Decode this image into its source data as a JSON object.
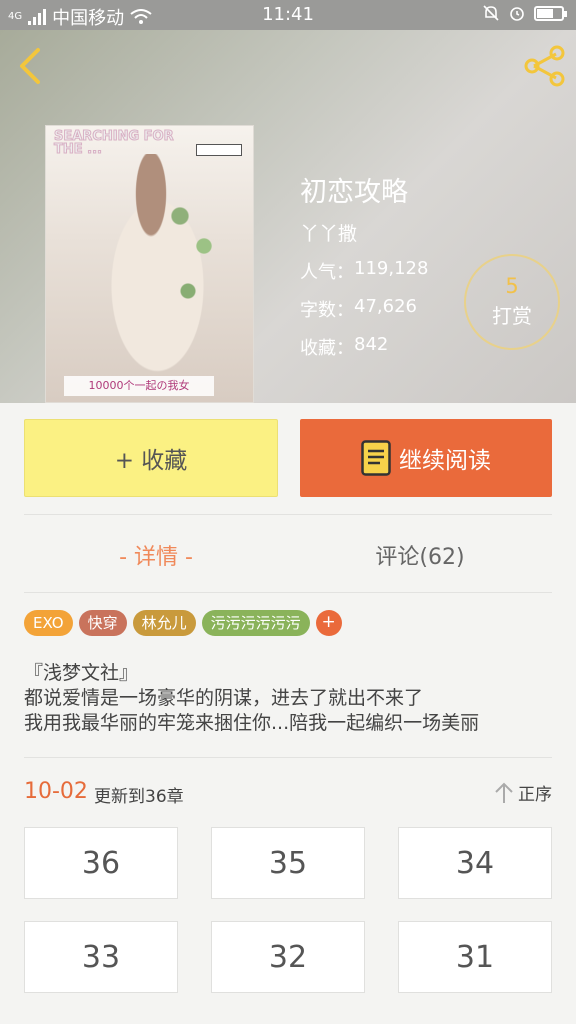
{
  "status_bar": {
    "network": "4G",
    "carrier": "中国移动",
    "time": "11:41"
  },
  "book": {
    "title": "初恋攻略",
    "author": "丫丫撒",
    "popularity_label": "人气：",
    "popularity": "119,128",
    "words_label": "字数：",
    "words": "47,626",
    "favorites_label": "收藏：",
    "favorites": "842",
    "cover_text": "10000个一起の我女",
    "cover_title": "SEARCHING FOR THE ..."
  },
  "reward": {
    "count": "5",
    "label": "打赏"
  },
  "actions": {
    "collect_label": "+ 收藏",
    "read_label": "继续阅读"
  },
  "tabs": {
    "detail": "- 详情 -",
    "comments": "评论(62)"
  },
  "tags": [
    {
      "label": "EXO",
      "color": "#f3a338"
    },
    {
      "label": "快穿",
      "color": "#c9735c"
    },
    {
      "label": "林允儿",
      "color": "#c99a3c"
    },
    {
      "label": "污污污污污污",
      "color": "#8ab35a"
    }
  ],
  "tag_add_label": "+",
  "description": {
    "line1": "『浅梦文社』",
    "line2": "都说爱情是一场豪华的阴谋，进去了就出不来了",
    "line3": "我用我最华丽的牢笼来捆住你...陪我一起编织一场美丽"
  },
  "update": {
    "date": "10-02",
    "text": "更新到36章",
    "order_label": "正序"
  },
  "chapters": [
    "36",
    "35",
    "34",
    "33",
    "32",
    "31"
  ],
  "colors": {
    "accent_orange": "#ea6a3b",
    "collect_yellow": "#fbf183",
    "reward_gold": "#f2c14a"
  }
}
